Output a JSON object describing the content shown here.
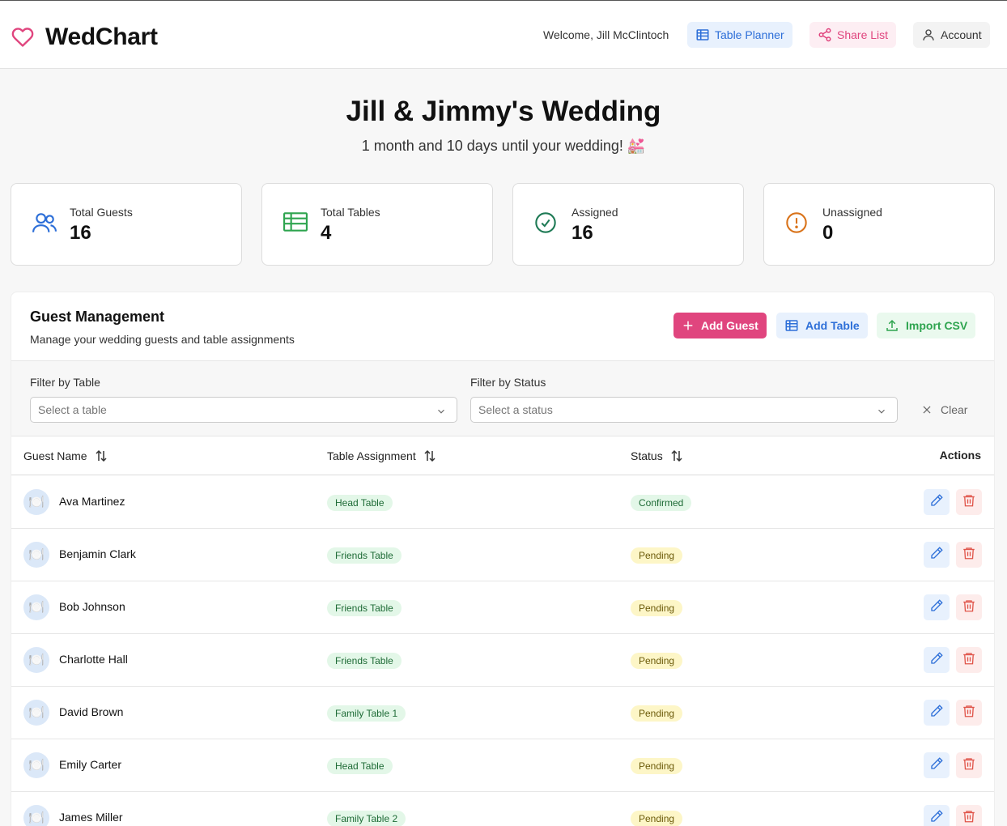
{
  "header": {
    "brand": "WedChart",
    "welcome": "Welcome, Jill McClintoch",
    "planner_label": "Table Planner",
    "share_label": "Share List",
    "account_label": "Account"
  },
  "hero": {
    "title": "Jill & Jimmy's Wedding",
    "countdown": "1 month and 10 days until your wedding! 💒"
  },
  "stats": [
    {
      "label": "Total Guests",
      "value": "16",
      "icon": "users-icon"
    },
    {
      "label": "Total Tables",
      "value": "4",
      "icon": "table-icon"
    },
    {
      "label": "Assigned",
      "value": "16",
      "icon": "check-circle-icon"
    },
    {
      "label": "Unassigned",
      "value": "0",
      "icon": "alert-circle-icon"
    }
  ],
  "panel": {
    "title": "Guest Management",
    "description": "Manage your wedding guests and table assignments",
    "add_guest_label": "Add Guest",
    "add_table_label": "Add Table",
    "import_label": "Import CSV"
  },
  "filters": {
    "table_label": "Filter by Table",
    "table_placeholder": "Select a table",
    "status_label": "Filter by Status",
    "status_placeholder": "Select a status",
    "clear_label": "Clear"
  },
  "table": {
    "columns": [
      "Guest Name",
      "Table Assignment",
      "Status",
      "Actions"
    ],
    "rows": [
      {
        "name": "Ava Martinez",
        "table": "Head Table",
        "status": "Confirmed"
      },
      {
        "name": "Benjamin Clark",
        "table": "Friends Table",
        "status": "Pending"
      },
      {
        "name": "Bob Johnson",
        "table": "Friends Table",
        "status": "Pending"
      },
      {
        "name": "Charlotte Hall",
        "table": "Friends Table",
        "status": "Pending"
      },
      {
        "name": "David Brown",
        "table": "Family Table 1",
        "status": "Pending"
      },
      {
        "name": "Emily Carter",
        "table": "Head Table",
        "status": "Pending"
      },
      {
        "name": "James Miller",
        "table": "Family Table 2",
        "status": "Pending"
      }
    ]
  },
  "colors": {
    "brand_pink": "#e0457e",
    "blue": "#2d6fd8",
    "green": "#2ea44f",
    "orange": "#d9731a"
  }
}
